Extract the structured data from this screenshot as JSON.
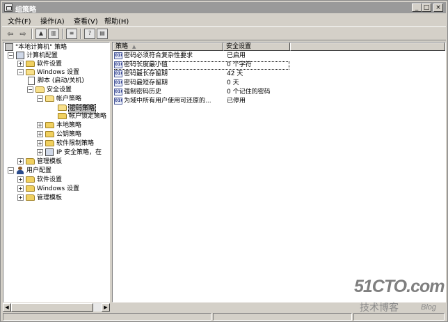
{
  "window": {
    "title": "组策略"
  },
  "menu": {
    "items": [
      "文件(F)",
      "操作(A)",
      "查看(V)",
      "帮助(H)"
    ]
  },
  "toolbar": {
    "icons": [
      "back-arrow-icon",
      "forward-arrow-icon",
      "up-folder-icon",
      "show-hide-tree-icon",
      "export-list-icon",
      "help-icon",
      "properties-icon"
    ]
  },
  "tree": {
    "root": "\"本地计算机\" 策略",
    "computer_config": "计算机配置",
    "software_settings": "软件设置",
    "windows_settings": "Windows 设置",
    "scripts": "脚本 (启动/关机)",
    "security_settings": "安全设置",
    "account_policies": "帐户策略",
    "password_policy": "密码策略",
    "lockout_policy": "帐户锁定策略",
    "local_policies": "本地策略",
    "public_key_policies": "公钥策略",
    "software_restriction": "软件限制策略",
    "ip_security": "IP 安全策略，在",
    "admin_templates": "管理模板",
    "user_config": "用户配置",
    "user_software_settings": "软件设置",
    "user_windows_settings": "Windows 设置",
    "user_admin_templates": "管理模板"
  },
  "list": {
    "columns": [
      "策略",
      "安全设置"
    ],
    "rows": [
      {
        "policy": "密码必须符合复杂性要求",
        "setting": "已启用"
      },
      {
        "policy": "密码长度最小值",
        "setting": "0 个字符"
      },
      {
        "policy": "密码最长存留期",
        "setting": "42 天"
      },
      {
        "policy": "密码最短存留期",
        "setting": "0 天"
      },
      {
        "policy": "强制密码历史",
        "setting": "0 个记住的密码"
      },
      {
        "policy": "为域中所有用户使用可还原的...",
        "setting": "已停用"
      }
    ]
  },
  "watermark": {
    "main": "51CTO.com",
    "sub": "技术博客",
    "blog": "Blog"
  }
}
